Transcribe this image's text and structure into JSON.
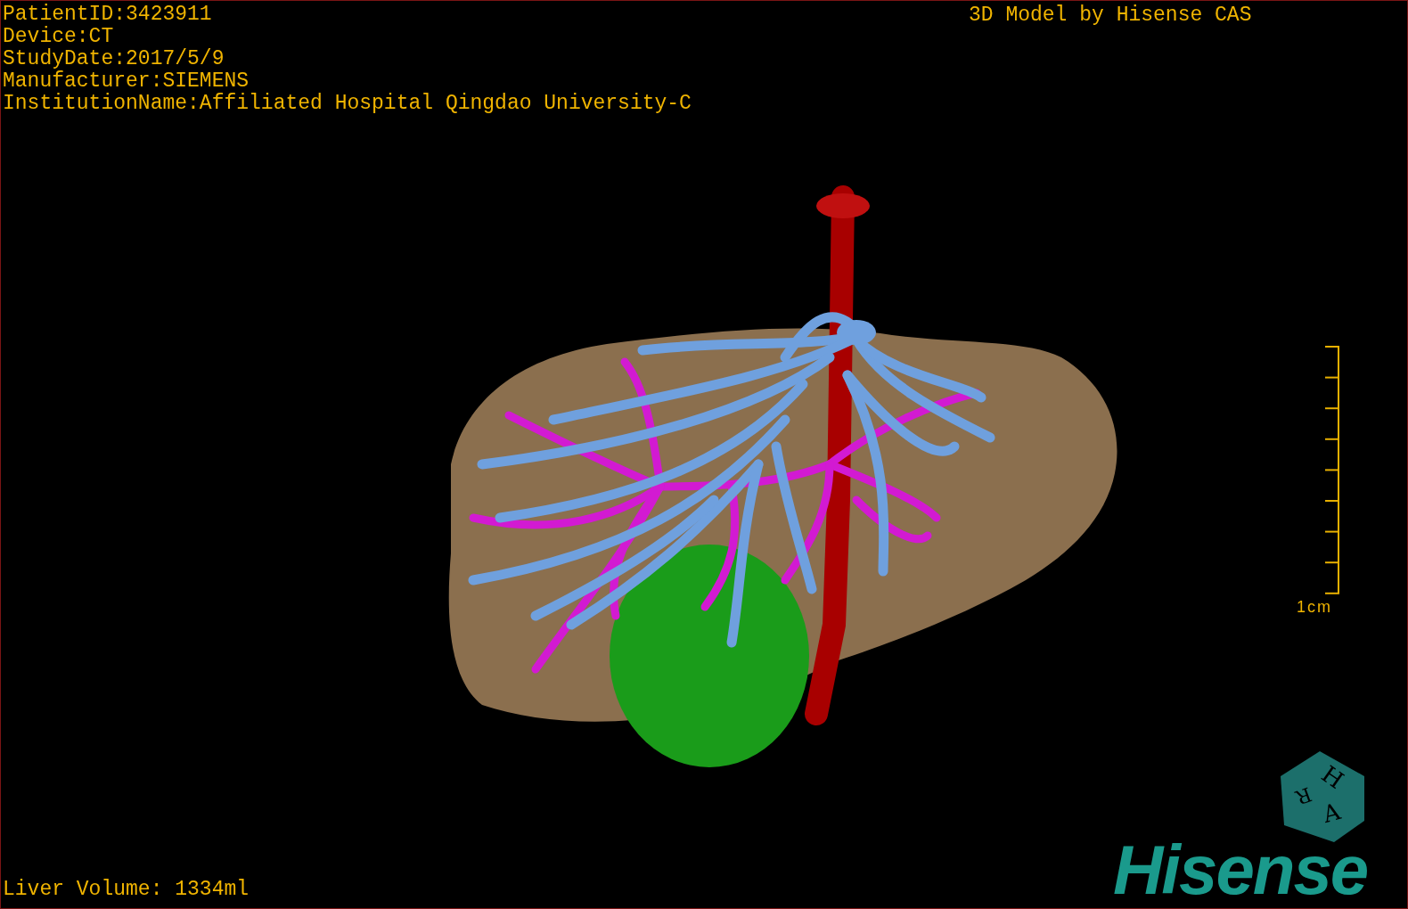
{
  "patient_info": [
    "PatientID:3423911",
    "Device:CT",
    "StudyDate:2017/5/9",
    "Manufacturer:SIEMENS",
    "InstitutionName:Affiliated Hospital Qingdao University-C"
  ],
  "title": "3D Model by Hisense CAS",
  "scale_bar": {
    "label": "1cm"
  },
  "orientation_cube": {
    "labels": [
      "H",
      "R",
      "A"
    ]
  },
  "logo": "Hisense",
  "liver_volume": "Liver Volume: 1334ml"
}
